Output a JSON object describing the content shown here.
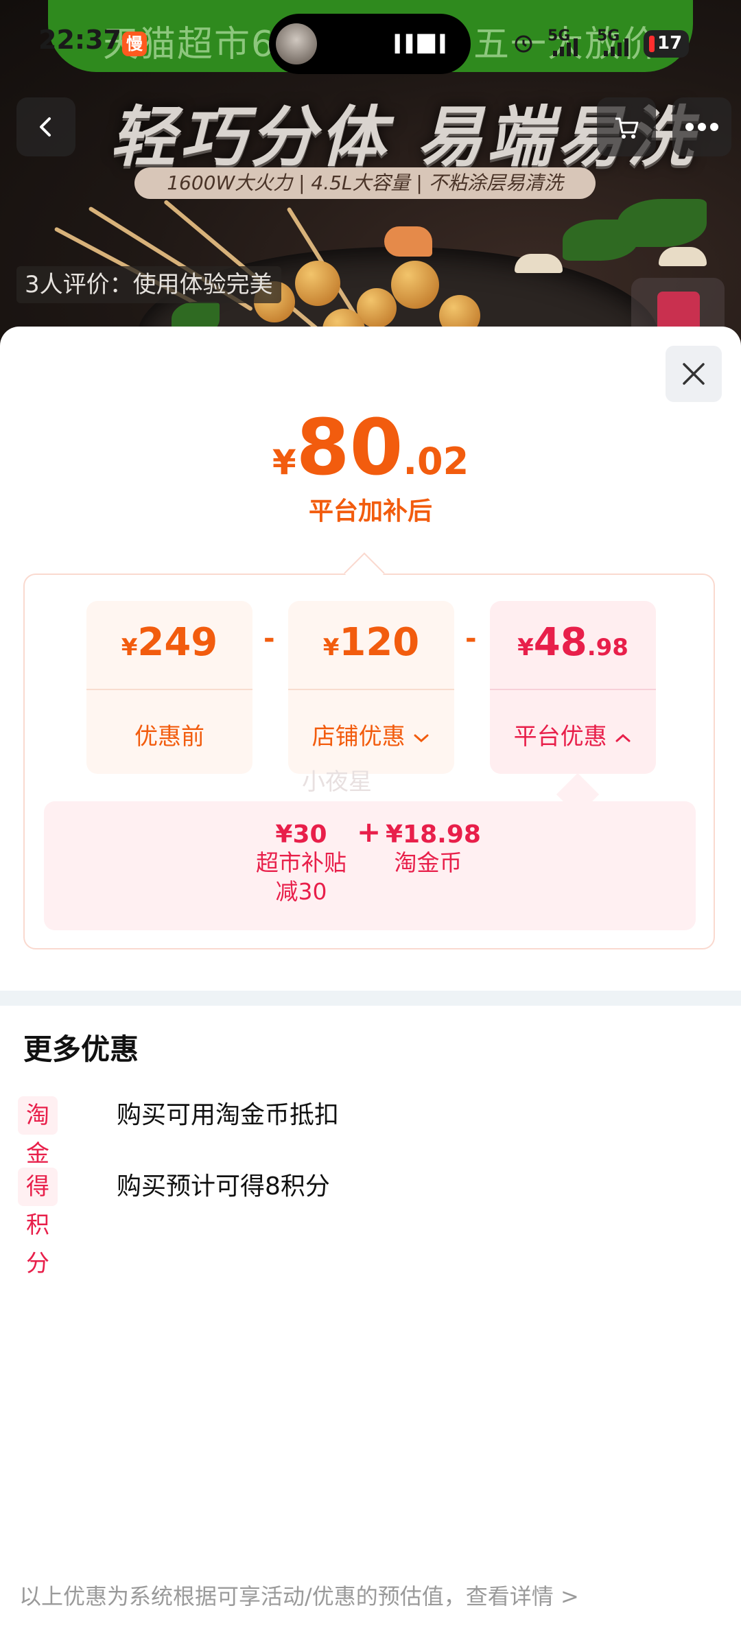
{
  "status_bar": {
    "time": "22:37",
    "app_badge": "慢",
    "network_1": "5G",
    "network_2": "5G",
    "battery": "17"
  },
  "hero": {
    "banner_left": "天猫超市6",
    "banner_right": "五一大放价",
    "headline": "轻巧分体 易端易洗",
    "subline": "1600W大火力 | 4.5L大容量 | 不粘涂层易清洗",
    "review_tag": "3人评价：使用体验完美"
  },
  "sheet": {
    "final_price": {
      "currency": "¥",
      "integer": "80",
      "decimal": ".02"
    },
    "final_label": "平台加补后",
    "cards": [
      {
        "currency": "¥",
        "integer": "249",
        "decimal": "",
        "label": "优惠前"
      },
      {
        "currency": "¥",
        "integer": "120",
        "decimal": "",
        "label": "店铺优惠"
      },
      {
        "currency": "¥",
        "integer": "48",
        "decimal": ".98",
        "label": "平台优惠"
      }
    ],
    "operators": [
      "-",
      "-"
    ],
    "platform_items": [
      {
        "amount": "¥30",
        "line1": "超市补贴",
        "line2": "减30"
      },
      {
        "amount": "¥18.98",
        "line1": "淘金币",
        "line2": ""
      }
    ],
    "plus": "+",
    "watermark": "小夜星",
    "more_title": "更多优惠",
    "more_items": [
      {
        "tag": "淘金币",
        "text": "购买可用淘金币抵扣"
      },
      {
        "tag": "得积分",
        "text": "购买预计可得8积分"
      }
    ],
    "footer_note": "以上优惠为系统根据可享活动/优惠的预估值，查看详情 >"
  },
  "colors": {
    "accent_orange": "#f25c0e",
    "accent_red": "#e81f4a",
    "sheet_bg": "#ffffff"
  }
}
